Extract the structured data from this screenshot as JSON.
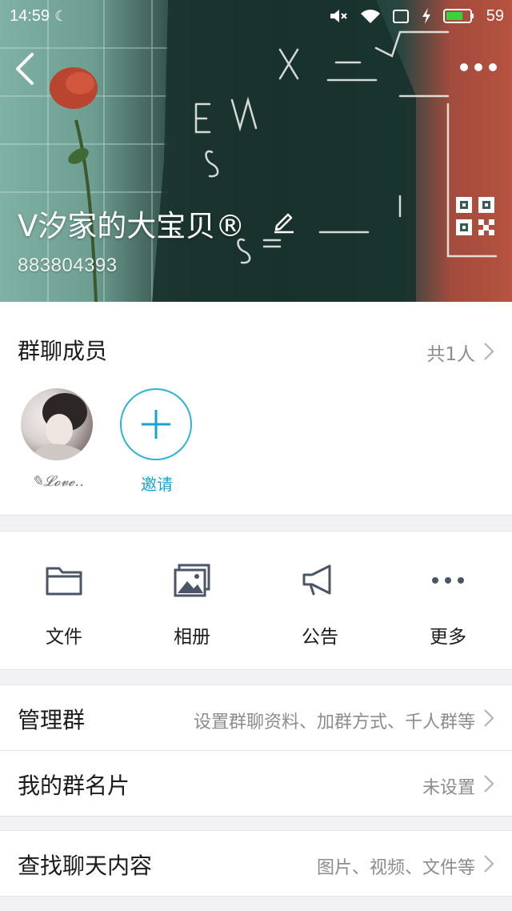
{
  "status_bar": {
    "time": "14:59",
    "battery_level": "59",
    "icons": [
      "moon-icon",
      "mute-icon",
      "wifi-icon",
      "screen-icon",
      "charging-icon",
      "battery-icon"
    ]
  },
  "header": {
    "group_name": "V汐家的大宝贝®",
    "group_id": "883804393",
    "icons": [
      "back-arrow-icon",
      "more-dots-icon",
      "edit-pencil-icon",
      "qr-code-icon"
    ]
  },
  "members": {
    "title": "群聊成员",
    "count": "共1人",
    "list": [
      {
        "name": "✎𝓛𝓸𝓿𝓮.."
      }
    ],
    "invite_label": "邀请"
  },
  "tools": [
    {
      "label": "文件",
      "icon": "folder-icon"
    },
    {
      "label": "相册",
      "icon": "photo-album-icon"
    },
    {
      "label": "公告",
      "icon": "megaphone-icon"
    },
    {
      "label": "更多",
      "icon": "more-dots-icon"
    }
  ],
  "rows": {
    "manage": {
      "title": "管理群",
      "value": "设置群聊资料、加群方式、千人群等"
    },
    "card": {
      "title": "我的群名片",
      "value": "未设置"
    },
    "search": {
      "title": "查找聊天内容",
      "value": "图片、视频、文件等"
    }
  },
  "colors": {
    "accent": "#17a3d1",
    "text": "#1b1b1b",
    "secondary": "#8c8c90",
    "background": "#f2f2f4"
  }
}
